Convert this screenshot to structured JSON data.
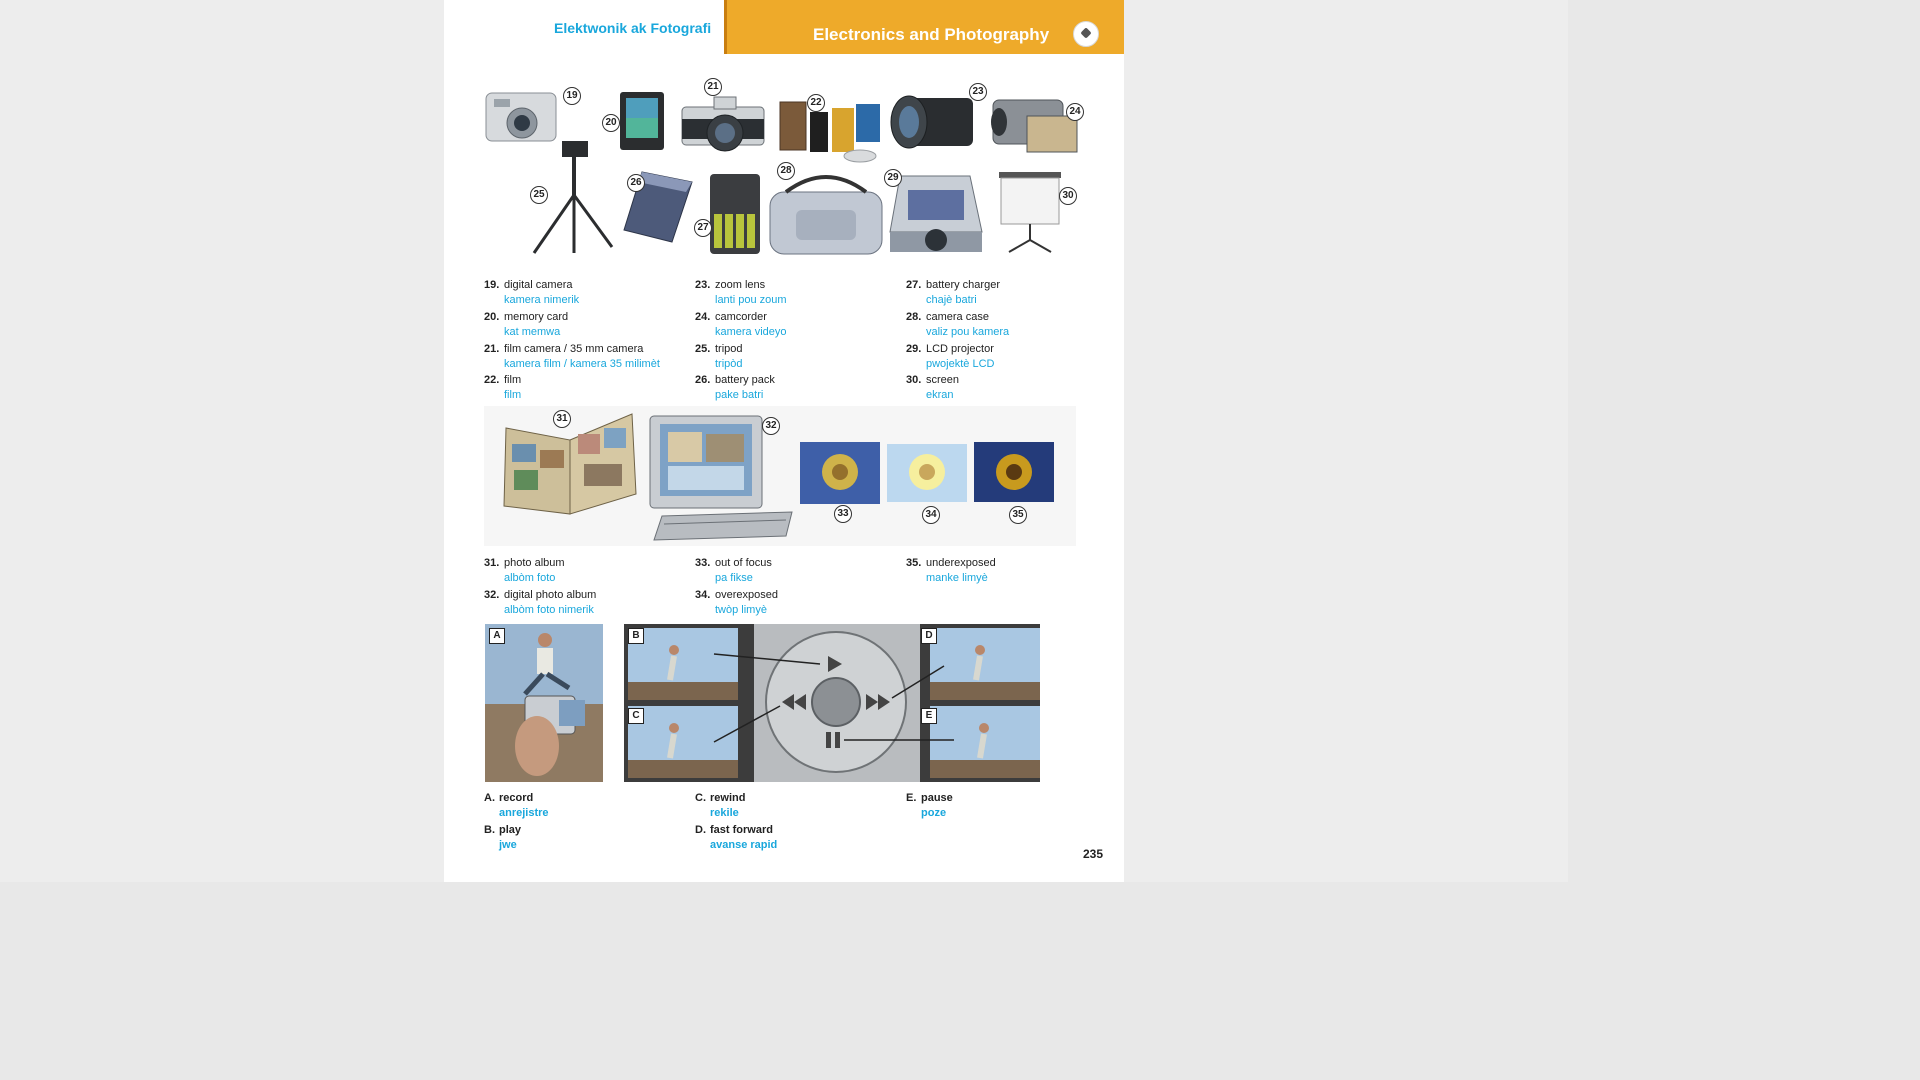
{
  "header": {
    "left_title": "Elektwonik ak Fotografi",
    "right_title": "Electronics and Photography"
  },
  "markers": [
    "19",
    "20",
    "21",
    "22",
    "23",
    "24",
    "25",
    "26",
    "27",
    "28",
    "29",
    "30",
    "31",
    "32",
    "33",
    "34",
    "35"
  ],
  "vocab_top": [
    {
      "num": "19.",
      "en": "digital camera",
      "ht": "kamera nimerik"
    },
    {
      "num": "20.",
      "en": "memory card",
      "ht": "kat memwa"
    },
    {
      "num": "21.",
      "en": "film camera / 35 mm camera",
      "ht": "kamera film / kamera 35 milimèt"
    },
    {
      "num": "22.",
      "en": "film",
      "ht": "film"
    },
    {
      "num": "23.",
      "en": "zoom lens",
      "ht": "lanti pou zoum"
    },
    {
      "num": "24.",
      "en": "camcorder",
      "ht": "kamera videyo"
    },
    {
      "num": "25.",
      "en": "tripod",
      "ht": "tripòd"
    },
    {
      "num": "26.",
      "en": "battery pack",
      "ht": "pake batri"
    },
    {
      "num": "27.",
      "en": "battery charger",
      "ht": "chajè batri"
    },
    {
      "num": "28.",
      "en": "camera case",
      "ht": "valiz pou kamera"
    },
    {
      "num": "29.",
      "en": "LCD projector",
      "ht": "pwojektè LCD"
    },
    {
      "num": "30.",
      "en": "screen",
      "ht": "ekran"
    }
  ],
  "vocab_mid": [
    {
      "num": "31.",
      "en": "photo album",
      "ht": "albòm foto"
    },
    {
      "num": "32.",
      "en": "digital photo album",
      "ht": "albòm foto nimerik"
    },
    {
      "num": "33.",
      "en": "out of focus",
      "ht": "pa fikse"
    },
    {
      "num": "34.",
      "en": "overexposed",
      "ht": "twòp limyè"
    },
    {
      "num": "35.",
      "en": "underexposed",
      "ht": "manke limyè"
    }
  ],
  "vocab_bottom": [
    {
      "num": "A.",
      "en": "record",
      "ht": "anrejistre"
    },
    {
      "num": "B.",
      "en": "play",
      "ht": "jwe"
    },
    {
      "num": "C.",
      "en": "rewind",
      "ht": "rekile"
    },
    {
      "num": "D.",
      "en": "fast forward",
      "ht": "avanse rapid"
    },
    {
      "num": "E.",
      "en": "pause",
      "ht": "poze"
    }
  ],
  "panel_tags": [
    "A",
    "B",
    "C",
    "D",
    "E"
  ],
  "page_number": "235"
}
